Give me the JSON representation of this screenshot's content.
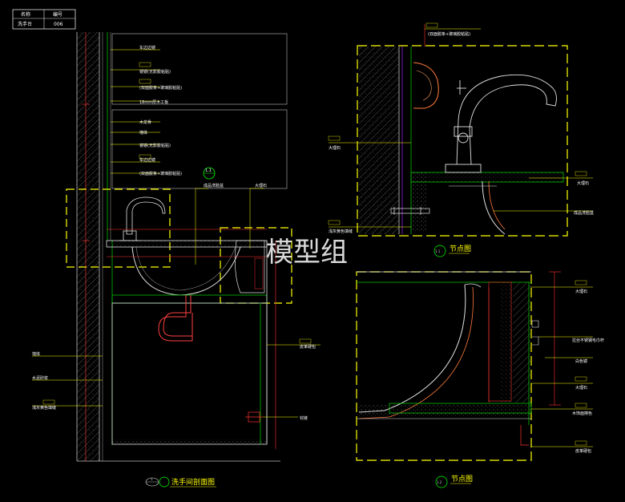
{
  "title_block": {
    "name_header": "名称",
    "number_header": "编号",
    "name_value": "洗手台",
    "number_value": "006"
  },
  "watermark": "模型组",
  "drawings": {
    "section": {
      "badge": "1",
      "title": "洗手间剖面图"
    },
    "detail_1": {
      "badge": "1.1",
      "title": "节点图"
    },
    "detail_2": {
      "badge": "1.2",
      "title": "节点图"
    }
  },
  "callout_section": "1.1",
  "labels_left": {
    "top_1": "车边边镜",
    "top_2": "镜镜(无影胶粘贴)",
    "top_3": "(双面胶条+玻璃胶粘贴)",
    "top_4": "18mm厚木工板",
    "mid_1": "木龙骨",
    "mid_2": "墙体",
    "mid_3": "镜镜(无影胶粘贴)",
    "mid_4": "车边边镜",
    "mid_5": "(双面胶条+玻璃胶粘贴)",
    "basin": "成品洗脸盆",
    "stone": "大理石",
    "wall": "墙体",
    "mortar": "水泥砂浆",
    "grout": "浅灰黄色填缝",
    "leather_pack": "皮革硬包",
    "hinge": "铰链"
  },
  "labels_detail_1": {
    "top": "(双面胶条+玻璃胶粘贴)",
    "marble_left": "大理石",
    "marble_right": "大理石",
    "basin": "成品洗脸盆",
    "grout": "浅灰黄色填缝"
  },
  "labels_detail_2": {
    "marble_top": "大理石",
    "towel": "拉丝不锈钢毛巾杆",
    "mirror": "白色镜",
    "marble_mid": "大理石",
    "paint": "木饰面擦色",
    "leather": "皮革硬包"
  },
  "colors": {
    "background": "#000000",
    "wall_outline": "#ffffff",
    "dim_line": "#ff3030",
    "leader": "#ffff00",
    "section_green": "#00c000",
    "pipe": "#ff4040",
    "hatch_gray": "#8a8a8a",
    "fixture_white": "#e0e0e0",
    "callout_circle": "#00ff00"
  }
}
